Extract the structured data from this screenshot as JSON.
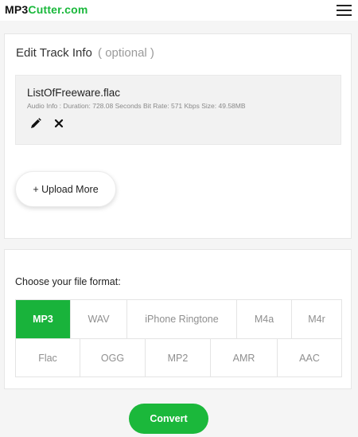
{
  "header": {
    "logo_part1": "MP3",
    "logo_part2": "Cutter.com"
  },
  "track_info": {
    "title": "Edit Track Info",
    "optional": "( optional )",
    "file": {
      "name": "ListOfFreeware.flac",
      "info": "Audio Info : Duration: 728.08 Seconds Bit Rate: 571 Kbps Size: 49.58MB"
    },
    "upload_more_label": "+ Upload More"
  },
  "formats": {
    "title": "Choose your file format:",
    "row1": [
      "MP3",
      "WAV",
      "iPhone Ringtone",
      "M4a",
      "M4r"
    ],
    "row2": [
      "Flac",
      "OGG",
      "MP2",
      "AMR",
      "AAC"
    ],
    "selected": "MP3"
  },
  "convert_label": "Convert",
  "colors": {
    "accent_green": "#19b33b",
    "logo_dark": "#111111"
  },
  "icons": [
    "menu-icon",
    "pencil-icon",
    "close-icon"
  ]
}
